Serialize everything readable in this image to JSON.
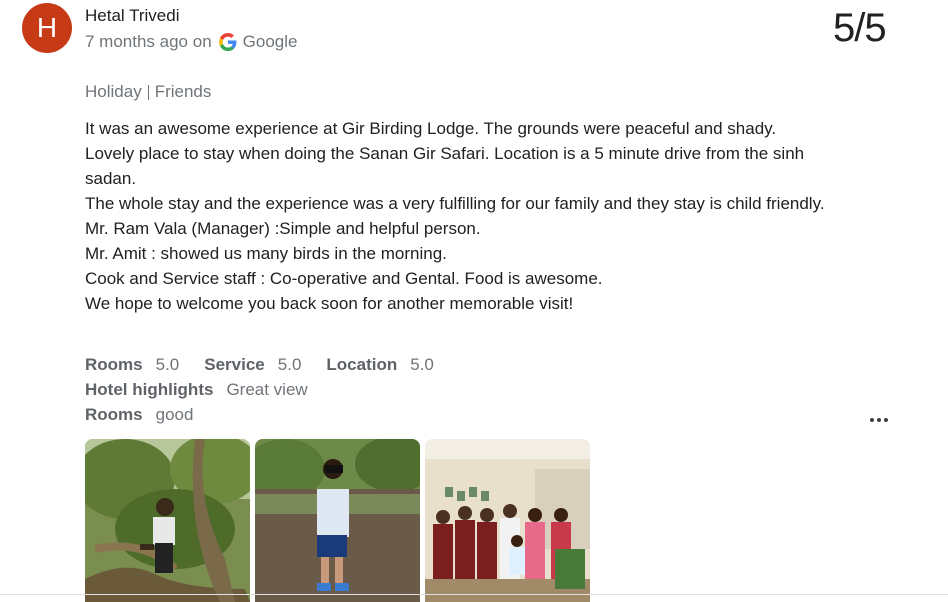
{
  "reviewer": {
    "initial": "H",
    "name": "Hetal Trivedi",
    "avatar_color": "#c73a16"
  },
  "meta": {
    "time": "7 months ago on",
    "source": "Google"
  },
  "score": "5/5",
  "trip": {
    "type": "Holiday",
    "group": "Friends"
  },
  "review_lines": [
    "It was an awesome experience at Gir Birding Lodge. The grounds were peaceful and shady.",
    "Lovely place to stay when doing the Sanan Gir Safari. Location is a 5 minute drive from the sinh sadan.",
    "The whole stay and the experience was a very fulfilling for our family and they stay is child friendly.",
    "Mr. Ram Vala (Manager) :Simple and helpful person.",
    "Mr. Amit : showed us many birds in the morning.",
    "Cook and Service staff : Co-operative and Gental. Food is awesome.",
    "We hope to welcome you back soon for another memorable visit!"
  ],
  "ratings": [
    {
      "label": "Rooms",
      "value": "5.0"
    },
    {
      "label": "Service",
      "value": "5.0"
    },
    {
      "label": "Location",
      "value": "5.0"
    }
  ],
  "highlights": {
    "label": "Hotel highlights",
    "value": "Great view"
  },
  "rooms_note": {
    "label": "Rooms",
    "value": "good"
  },
  "icons": {
    "more": "more-options-icon",
    "google": "google-logo-icon"
  }
}
